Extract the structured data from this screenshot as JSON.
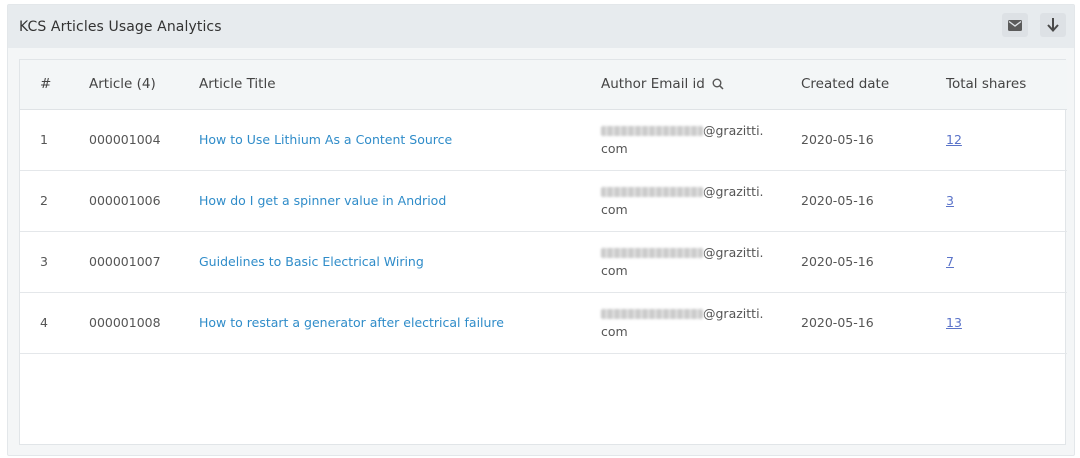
{
  "panel": {
    "title": "KCS Articles Usage Analytics",
    "mail_icon": "mail-icon",
    "download_icon": "download-arrow-icon"
  },
  "table": {
    "headers": {
      "index": "#",
      "article": "Article (4)",
      "title": "Article Title",
      "email": "Author Email id",
      "created": "Created date",
      "shares": "Total shares"
    },
    "rows": [
      {
        "index": "1",
        "article": "000001004",
        "title": "How to Use Lithium As a Content Source",
        "email_domain": "@grazitti.",
        "email_tld": "com",
        "created": "2020-05-16",
        "shares": "12"
      },
      {
        "index": "2",
        "article": "000001006",
        "title": "How do I get a spinner value in Andriod",
        "email_domain": "@grazitti.",
        "email_tld": "com",
        "created": "2020-05-16",
        "shares": "3"
      },
      {
        "index": "3",
        "article": "000001007",
        "title": "Guidelines to Basic Electrical Wiring",
        "email_domain": "@grazitti.",
        "email_tld": "com",
        "created": "2020-05-16",
        "shares": "7"
      },
      {
        "index": "4",
        "article": "000001008",
        "title": "How to restart a generator after electrical failure",
        "email_domain": "@grazitti.",
        "email_tld": "com",
        "created": "2020-05-16",
        "shares": "13"
      }
    ]
  },
  "colors": {
    "link": "#2f8cc9",
    "shares_link": "#5a73c9",
    "header_bg": "#e7ebee"
  }
}
